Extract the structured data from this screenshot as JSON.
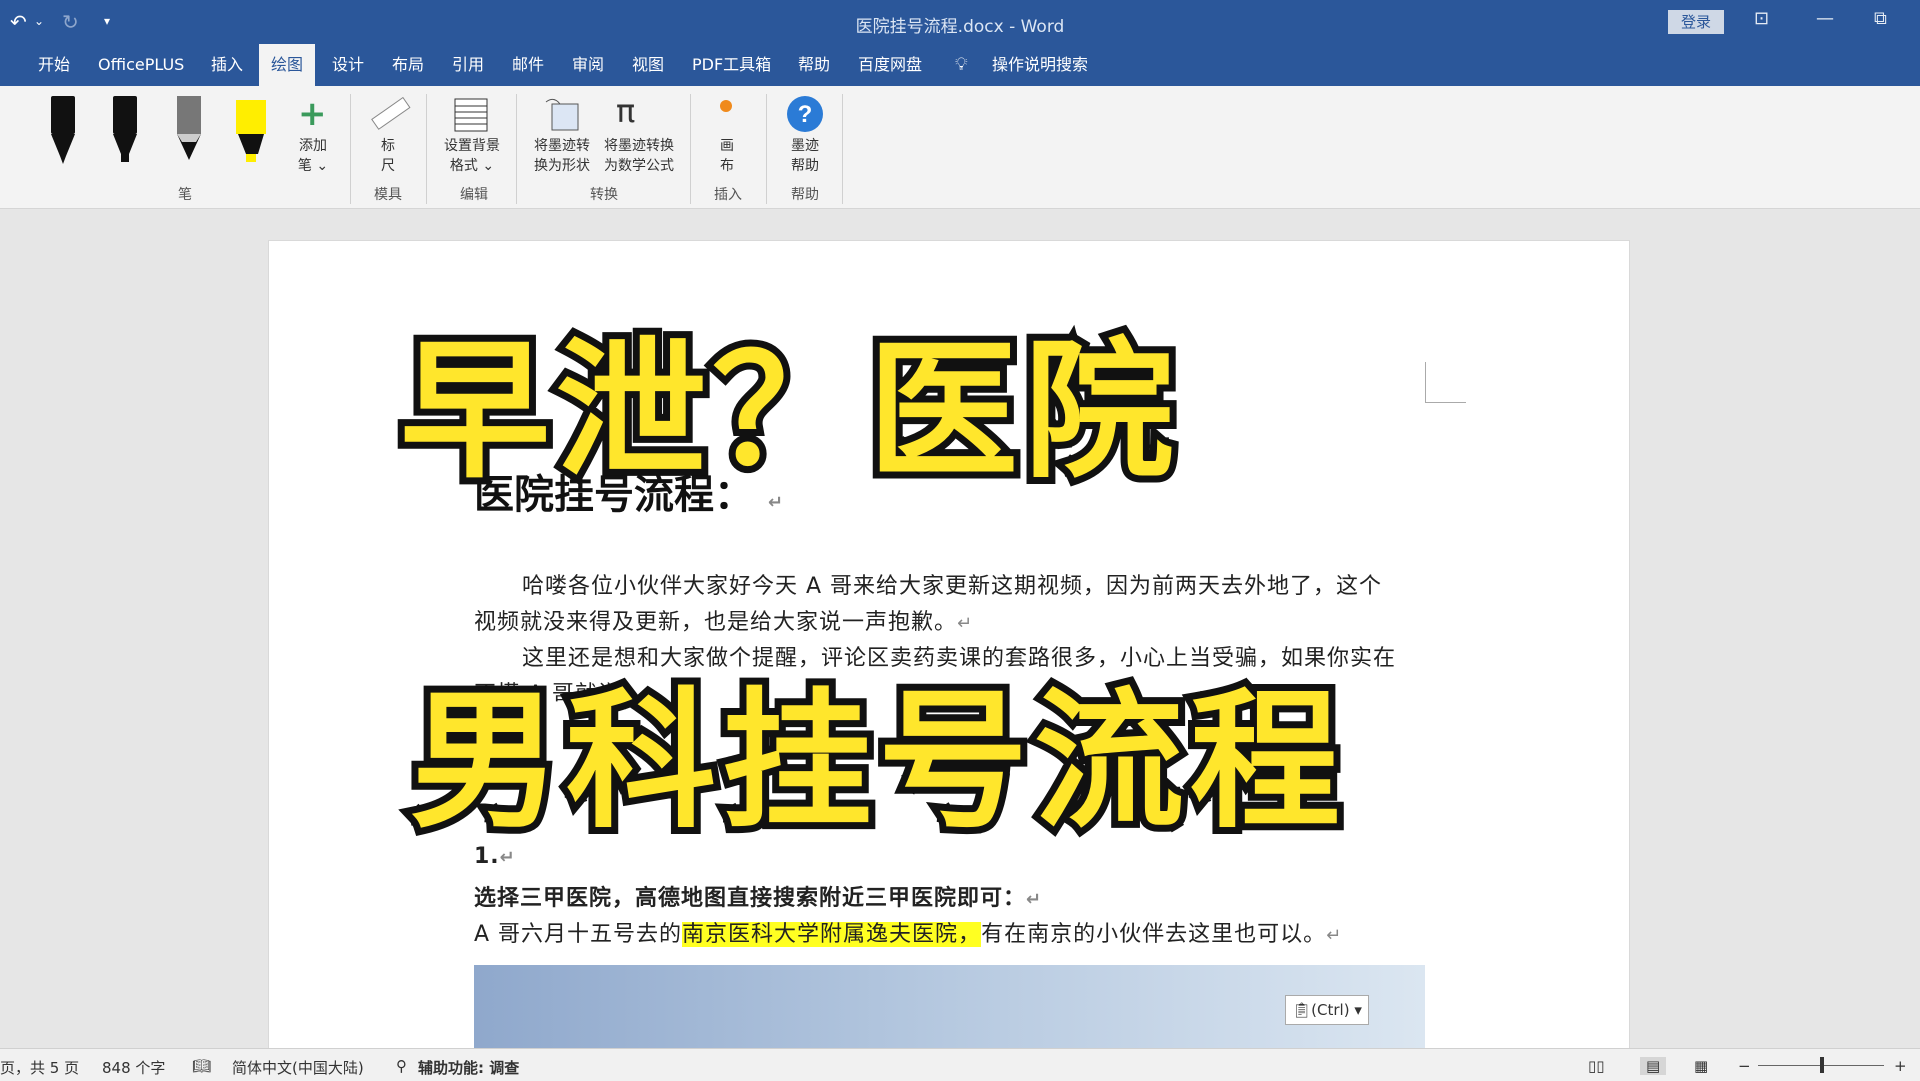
{
  "titlebar": {
    "title": "医院挂号流程.docx  -  Word",
    "login": "登录"
  },
  "tabs": [
    {
      "label": "开始"
    },
    {
      "label": "OfficePLUS"
    },
    {
      "label": "插入"
    },
    {
      "label": "绘图",
      "active": true
    },
    {
      "label": "设计"
    },
    {
      "label": "布局"
    },
    {
      "label": "引用"
    },
    {
      "label": "邮件"
    },
    {
      "label": "审阅"
    },
    {
      "label": "视图"
    },
    {
      "label": "PDF工具箱"
    },
    {
      "label": "帮助"
    },
    {
      "label": "百度网盘"
    },
    {
      "label": "操作说明搜索"
    }
  ],
  "ribbon": {
    "add_pen": [
      "添加",
      "笔 ⌄"
    ],
    "ruler": [
      "标",
      "尺"
    ],
    "bg_format": [
      "设置背景",
      "格式 ⌄"
    ],
    "ink_to_shape": [
      "将墨迹转",
      "换为形状"
    ],
    "ink_to_math": [
      "将墨迹转换",
      "为数学公式"
    ],
    "canvas": [
      "画",
      "布"
    ],
    "ink_help": [
      "墨迹",
      "帮助"
    ],
    "groups": {
      "pens": "笔",
      "stencils": "模具",
      "edit": "编辑",
      "convert": "转换",
      "insert": "插入",
      "help": "帮助"
    },
    "colors": {
      "pen_black": "#111111",
      "pen_gray": "#777777",
      "highlighter": "#ffee00",
      "plus": "#3a9a5b"
    }
  },
  "document": {
    "heading": "医院挂号流程：",
    "para1_line1": "哈喽各位小伙伴大家好今天 A 哥来给大家更新这期视频，因为前两天去外地了，这个",
    "para1_line2": "视频就没来得及更新，也是给大家说一声抱歉。",
    "para2_line1": "这里还是想和大家做个提醒，评论区卖药卖课的套路很多，小心上当受骗，如果你实在",
    "para2_line2": "不懂 A 哥就说",
    "item_number": "1.",
    "item_title": "选择三甲医院，高德地图直接搜索附近三甲医院即可：",
    "item_line_pre": "A 哥六月十五号去的",
    "item_line_highlight": "南京医科大学附属逸夫医院，",
    "item_line_post": "有在南京的小伙伴去这里也可以。",
    "paste_button": "(Ctrl) ▾",
    "paragraph_mark": "↵"
  },
  "overlay": {
    "line1": "早泄？医院",
    "line2": "男科挂号流程"
  },
  "status": {
    "page": "页，共 5 页",
    "words": "848 个字",
    "language": "简体中文(中国大陆)",
    "accessibility": "辅助功能: 调查"
  }
}
